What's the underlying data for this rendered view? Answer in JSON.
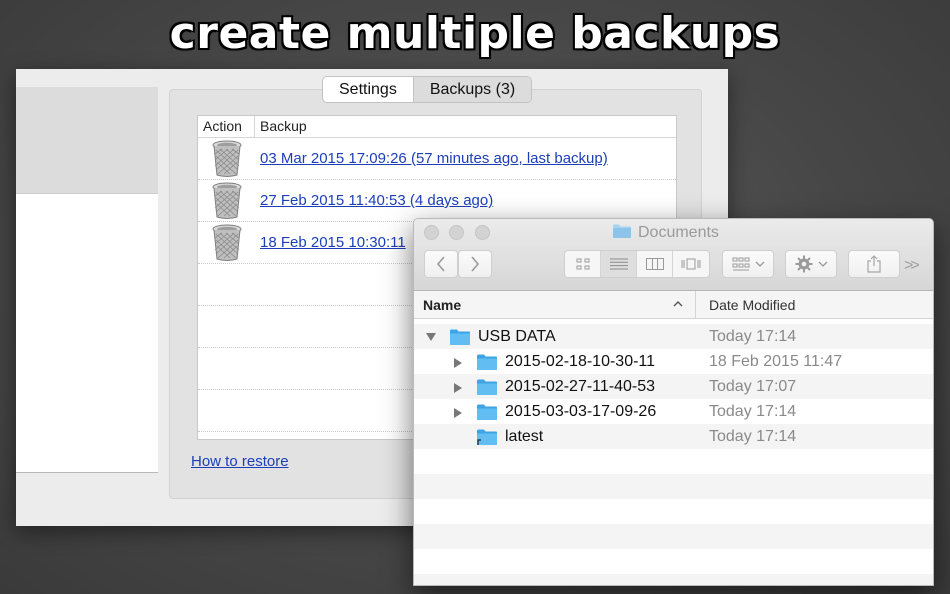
{
  "headline": "create multiple backups",
  "backup_app": {
    "tabs": [
      {
        "label": "Settings",
        "active": false
      },
      {
        "label": "Backups (3)",
        "active": true
      }
    ],
    "table": {
      "columns": [
        "Action",
        "Backup"
      ],
      "rows": [
        {
          "action_icon": "trash-icon",
          "label": "03 Mar 2015 17:09:26 (57 minutes ago, last backup)"
        },
        {
          "action_icon": "trash-icon",
          "label": "27 Feb 2015 11:40:53 (4 days ago)"
        },
        {
          "action_icon": "trash-icon",
          "label": "18 Feb 2015 10:30:11"
        }
      ]
    },
    "restore_link": "How to restore",
    "link_color": "#1c3fb8"
  },
  "finder": {
    "title": "Documents",
    "columns": {
      "name": "Name",
      "date": "Date Modified"
    },
    "rows": [
      {
        "name": "USB DATA",
        "date": "Today 17:14",
        "level": 0,
        "expander": "expanded"
      },
      {
        "name": "2015-02-18-10-30-11",
        "date": "18 Feb 2015 11:47",
        "level": 1,
        "expander": "collapsed"
      },
      {
        "name": "2015-02-27-11-40-53",
        "date": "Today 17:07",
        "level": 1,
        "expander": "collapsed"
      },
      {
        "name": "2015-03-03-17-09-26",
        "date": "Today 17:14",
        "level": 1,
        "expander": "collapsed"
      },
      {
        "name": "latest",
        "date": "Today 17:14",
        "level": 1,
        "expander": "none",
        "alias": true
      }
    ],
    "folder_color": "#5bb8ee"
  }
}
